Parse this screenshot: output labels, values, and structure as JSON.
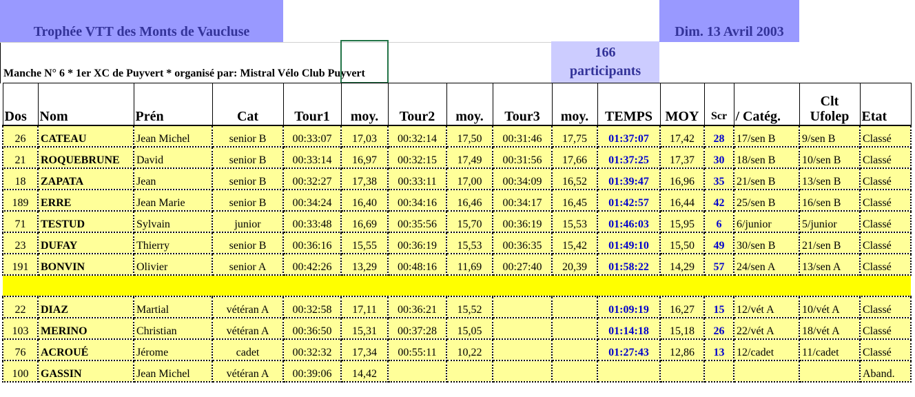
{
  "header": {
    "title": "Trophée VTT des Monts de Vaucluse",
    "date": "Dim. 13 Avril 2003",
    "participants_count": "166",
    "participants_label": "participants",
    "manche_text": "Manche N° 6 * 1er XC de Puyvert *   organisé par: Mistral Vélo Club Puyvert"
  },
  "columns": {
    "dos": "Dos",
    "nom": "Nom",
    "pren": "Prén",
    "cat": "Cat",
    "tour1": "Tour1",
    "moy1": "moy.",
    "tour2": "Tour2",
    "moy2": "moy.",
    "tour3": "Tour3",
    "moy3": "moy.",
    "temps": "TEMPS",
    "moy": "MOY",
    "scr": "Scr",
    "categ": "/ Catég.",
    "clt_line1": "Clt",
    "clt_line2": "Ufolep",
    "etat": "Etat"
  },
  "rows": [
    {
      "dos": "26",
      "nom": "CATEAU",
      "pren": "Jean Michel",
      "cat": "senior B",
      "tour1": "00:33:07",
      "moy1": "17,03",
      "tour2": "00:32:14",
      "moy2": "17,50",
      "tour3": "00:31:46",
      "moy3": "17,75",
      "temps": "01:37:07",
      "moy": "17,42",
      "scr": "28",
      "categ": "17/sen B",
      "clt": "9/sen B",
      "etat": "Classé"
    },
    {
      "dos": "21",
      "nom": "ROQUEBRUNE",
      "pren": "David",
      "cat": "senior B",
      "tour1": "00:33:14",
      "moy1": "16,97",
      "tour2": "00:32:15",
      "moy2": "17,49",
      "tour3": "00:31:56",
      "moy3": "17,66",
      "temps": "01:37:25",
      "moy": "17,37",
      "scr": "30",
      "categ": "18/sen B",
      "clt": "10/sen B",
      "etat": "Classé"
    },
    {
      "dos": "18",
      "nom": "ZAPATA",
      "pren": "Jean",
      "cat": "senior B",
      "tour1": "00:32:27",
      "moy1": "17,38",
      "tour2": "00:33:11",
      "moy2": "17,00",
      "tour3": "00:34:09",
      "moy3": "16,52",
      "temps": "01:39:47",
      "moy": "16,96",
      "scr": "35",
      "categ": "21/sen B",
      "clt": "13/sen B",
      "etat": "Classé"
    },
    {
      "dos": "189",
      "nom": "ERRE",
      "pren": "Jean Marie",
      "cat": "senior B",
      "tour1": "00:34:24",
      "moy1": "16,40",
      "tour2": "00:34:16",
      "moy2": "16,46",
      "tour3": "00:34:17",
      "moy3": "16,45",
      "temps": "01:42:57",
      "moy": "16,44",
      "scr": "42",
      "categ": "25/sen B",
      "clt": "16/sen B",
      "etat": "Classé"
    },
    {
      "dos": "71",
      "nom": "TESTUD",
      "pren": "Sylvain",
      "cat": "junior",
      "tour1": "00:33:48",
      "moy1": "16,69",
      "tour2": "00:35:56",
      "moy2": "15,70",
      "tour3": "00:36:19",
      "moy3": "15,53",
      "temps": "01:46:03",
      "moy": "15,95",
      "scr": "6",
      "categ": "6/junior",
      "clt": "5/junior",
      "etat": "Classé"
    },
    {
      "dos": "23",
      "nom": "DUFAY",
      "pren": "Thierry",
      "cat": "senior B",
      "tour1": "00:36:16",
      "moy1": "15,55",
      "tour2": "00:36:19",
      "moy2": "15,53",
      "tour3": "00:36:35",
      "moy3": "15,42",
      "temps": "01:49:10",
      "moy": "15,50",
      "scr": "49",
      "categ": "30/sen B",
      "clt": "21/sen B",
      "etat": "Classé"
    },
    {
      "dos": "191",
      "nom": "BONVIN",
      "pren": "Olivier",
      "cat": "senior A",
      "tour1": "00:42:26",
      "moy1": "13,29",
      "tour2": "00:48:16",
      "moy2": "11,69",
      "tour3": "00:27:40",
      "moy3": "20,39",
      "temps": "01:58:22",
      "moy": "14,29",
      "scr": "57",
      "categ": "24/sen A",
      "clt": "13/sen A",
      "etat": "Classé"
    },
    {
      "dos": "22",
      "nom": "DIAZ",
      "pren": "Martial",
      "cat": "vétéran A",
      "tour1": "00:32:58",
      "moy1": "17,11",
      "tour2": "00:36:21",
      "moy2": "15,52",
      "tour3": "",
      "moy3": "",
      "temps": "01:09:19",
      "moy": "16,27",
      "scr": "15",
      "categ": "12/vét A",
      "clt": "10/vét A",
      "etat": "Classé"
    },
    {
      "dos": "103",
      "nom": "MERINO",
      "pren": "Christian",
      "cat": "vétéran A",
      "tour1": "00:36:50",
      "moy1": "15,31",
      "tour2": "00:37:28",
      "moy2": "15,05",
      "tour3": "",
      "moy3": "",
      "temps": "01:14:18",
      "moy": "15,18",
      "scr": "26",
      "categ": "22/vét A",
      "clt": "18/vét A",
      "etat": "Classé"
    },
    {
      "dos": "76",
      "nom": "ACROUÉ",
      "pren": "Jérome",
      "cat": "cadet",
      "tour1": "00:32:32",
      "moy1": "17,34",
      "tour2": "00:55:11",
      "moy2": "10,22",
      "tour3": "",
      "moy3": "",
      "temps": "01:27:43",
      "moy": "12,86",
      "scr": "13",
      "categ": "12/cadet",
      "clt": "11/cadet",
      "etat": "Classé"
    },
    {
      "dos": "100",
      "nom": "GASSIN",
      "pren": "Jean Michel",
      "cat": "vétéran A",
      "tour1": "00:39:06",
      "moy1": "14,42",
      "tour2": "",
      "moy2": "",
      "tour3": "",
      "moy3": "",
      "temps": "",
      "moy": "",
      "scr": "",
      "categ": "",
      "clt": "",
      "etat": "Aband."
    }
  ],
  "separator_after_row": 7,
  "colors": {
    "title_bg": "#9999ff",
    "title_text": "#333399",
    "participants_bg": "#ccccff",
    "row_bg": "#ffff99",
    "separator_bg": "#ffff00",
    "time_text": "#0000cc",
    "selection": "#217346"
  }
}
